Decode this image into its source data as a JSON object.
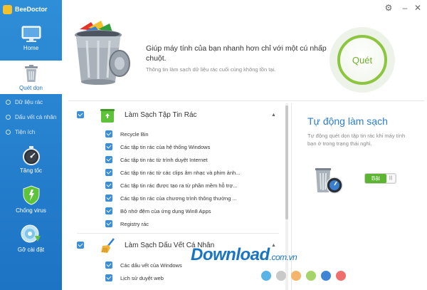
{
  "app": {
    "name": "BeeDoctor"
  },
  "sidebar": {
    "items": [
      {
        "label": "Home",
        "icon": "monitor-icon"
      },
      {
        "label": "Quét dọn",
        "icon": "trash-icon"
      },
      {
        "label": "Tăng tốc",
        "icon": "stopwatch-icon"
      },
      {
        "label": "Chống virus",
        "icon": "shield-icon"
      },
      {
        "label": "Gỡ cài đặt",
        "icon": "disc-remove-icon"
      }
    ],
    "sub_items": [
      {
        "label": "Dữ liệu rác"
      },
      {
        "label": "Dấu vết cá nhân"
      },
      {
        "label": "Tiện ích"
      }
    ]
  },
  "header": {
    "headline": "Giúp máy tính của bạn nhanh hơn chỉ với một cú nhấp chuột.",
    "subline": "Thông tin làm sạch dữ liệu rác cuối cùng không tồn tại.",
    "scan_label": "Quét"
  },
  "sections": [
    {
      "title": "Làm Sạch Tập Tin Rác",
      "icon": "recycle-icon",
      "items": [
        "Recycle Bin",
        "Các tập tin rác của hệ thống Windows",
        "Các tập tin rác từ trình duyệt Internet",
        "Các tập tin rác từ các clips âm nhạc và phim ảnh...",
        "Các tập tin rác được tạo ra từ phần mềm hỗ trợ...",
        "Các tập tin rác của chương trình thông thường ...",
        "Bộ nhớ đệm của ứng dụng Win8 Apps",
        "Registry rác"
      ]
    },
    {
      "title": "Làm Sạch Dấu Vết Cá Nhân",
      "icon": "broom-icon",
      "items": [
        "Các dấu vết của Windows",
        "Lịch sử duyệt web"
      ]
    }
  ],
  "auto_clean": {
    "title": "Tự động làm sạch",
    "description": "Tự động quét dọn tập tin rác khi máy tính bạn ở trong trạng thái nghỉ.",
    "toggle_label": "Bật"
  },
  "watermark": {
    "text": "Download",
    "suffix": ".com.vn"
  },
  "colors": {
    "sidebar": "#1d73c4",
    "accent_green": "#8cc63f",
    "title_blue": "#2a7fcf",
    "dots": [
      "#5ab3e6",
      "#c9c9c9",
      "#f2b56b",
      "#a5d46a",
      "#3f85d6",
      "#ef6f6f"
    ]
  }
}
